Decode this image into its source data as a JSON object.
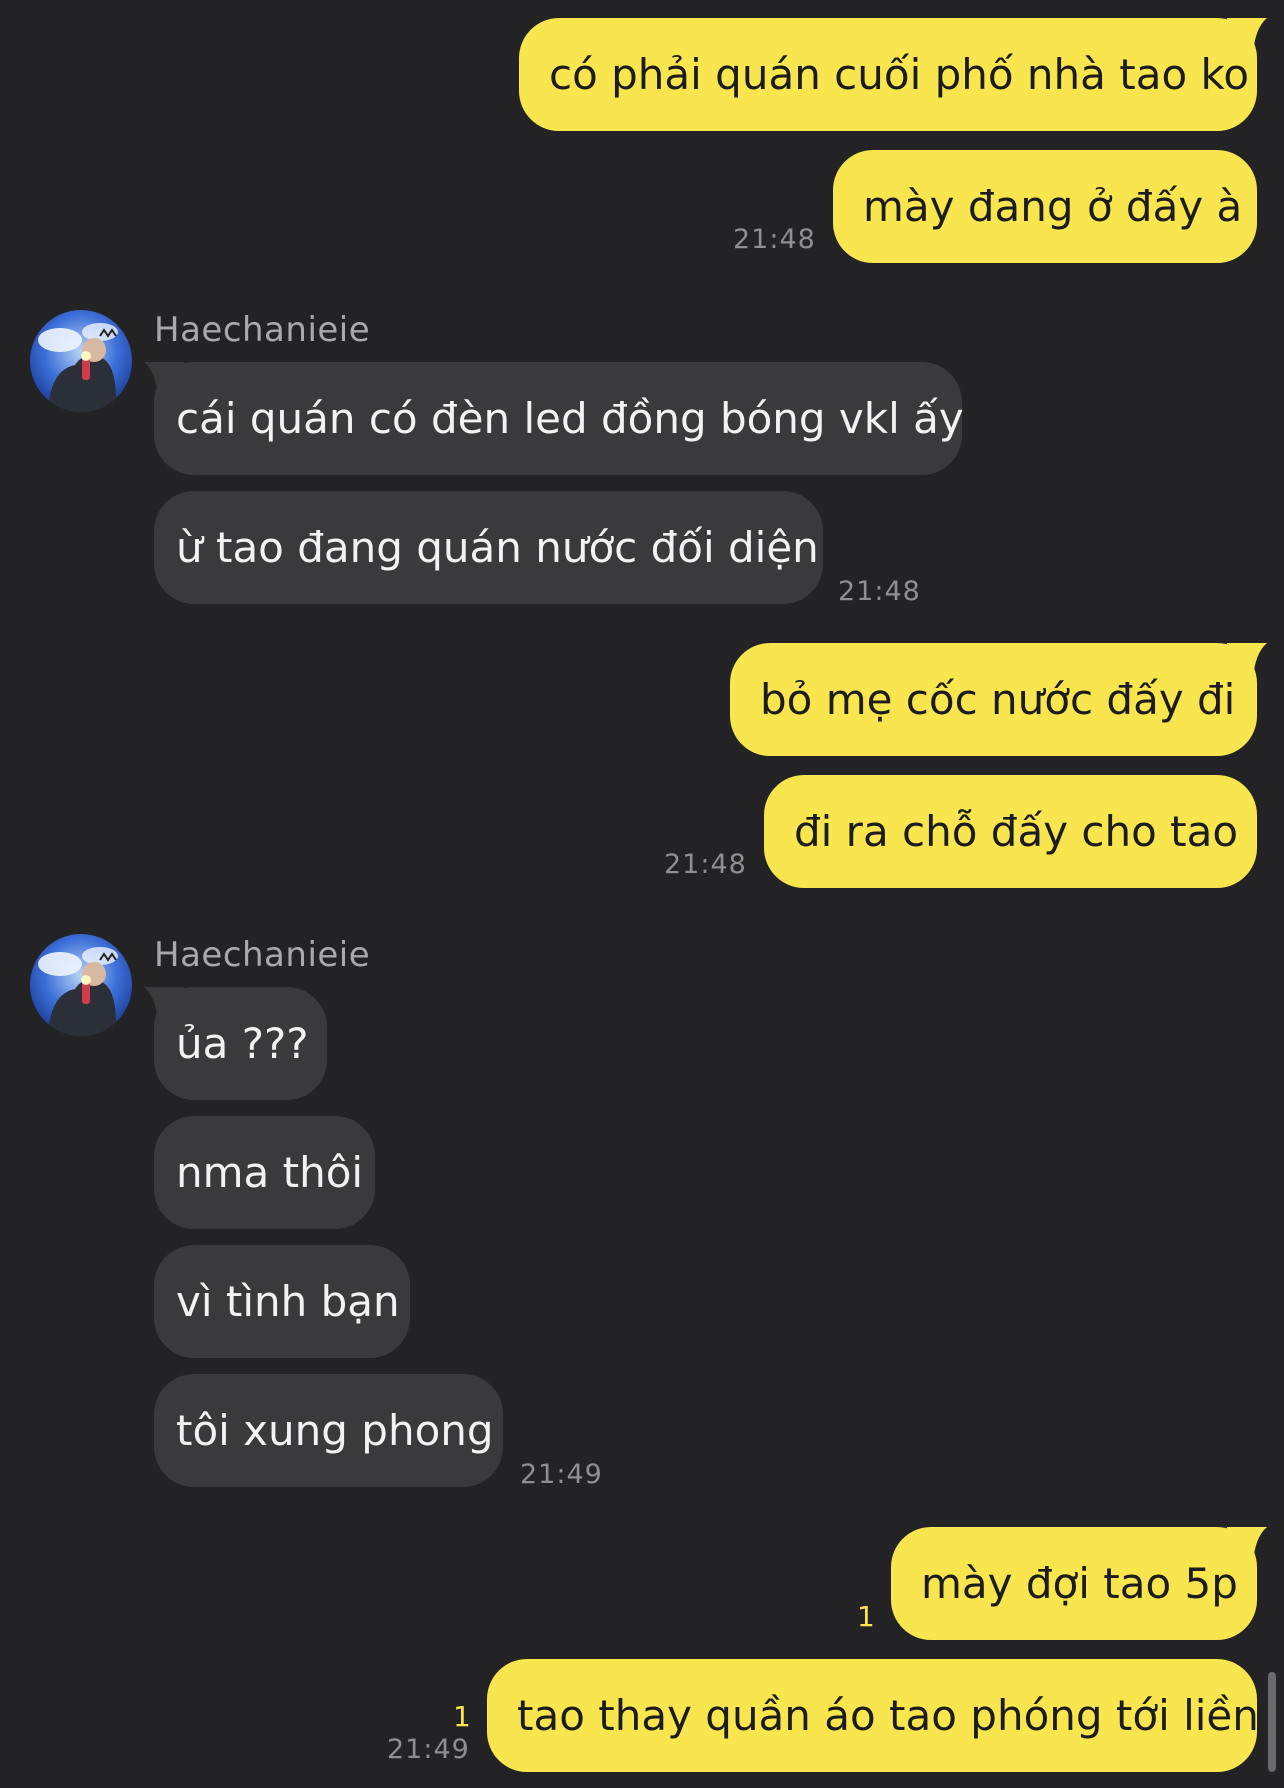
{
  "colors": {
    "background": "#232325",
    "outgoing_bubble": "#F9E54E",
    "incoming_bubble": "#3A3A3C",
    "timestamp": "#8E8E93",
    "unread_count": "#F9E54E"
  },
  "messages": {
    "m1": {
      "text": "có phải quán cuối phố nhà tao ko"
    },
    "m2": {
      "text": "mày đang ở đấy à",
      "time": "21:48"
    },
    "group1": {
      "sender": "Haechanieie"
    },
    "m3": {
      "text": "cái quán có đèn led đồng bóng vkl ấy"
    },
    "m4": {
      "text": "ừ tao đang quán nước đối diện",
      "time": "21:48"
    },
    "m5": {
      "text": "bỏ mẹ cốc nước đấy đi"
    },
    "m6": {
      "text": "đi ra chỗ đấy cho tao",
      "time": "21:48"
    },
    "group2": {
      "sender": "Haechanieie"
    },
    "m7": {
      "text": "ủa ???"
    },
    "m8": {
      "text": "nma thôi"
    },
    "m9": {
      "text": "vì tình bạn"
    },
    "m10": {
      "text": "tôi xung phong",
      "time": "21:49"
    },
    "m11": {
      "text": "mày đợi tao 5p",
      "unread": "1"
    },
    "m12": {
      "text": "tao thay quần áo tao phóng tới liền",
      "unread": "1",
      "time": "21:49"
    }
  },
  "icons": {
    "avatar": "profile-photo-avatar-icon",
    "tail_out": "bubble-tail-right-icon",
    "tail_in": "bubble-tail-left-icon"
  }
}
